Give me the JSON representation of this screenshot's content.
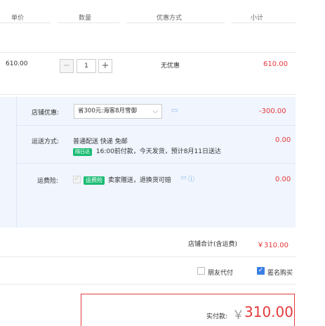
{
  "header": {
    "col_price": "单价",
    "col_qty": "数量",
    "col_discount": "优惠方式",
    "col_subtotal": "小计"
  },
  "item": {
    "unit_price": "610.00",
    "quantity": "1",
    "minus": "−",
    "plus": "+",
    "discount": "无优惠",
    "subtotal": "610.00"
  },
  "shop_discount": {
    "label": "店铺优惠:",
    "selected": "省300元:海客8月雪御",
    "amount": "-300.00"
  },
  "shipping": {
    "label": "运送方式:",
    "method": "普通配送 快递 免邮",
    "badge": "隔日达",
    "detail": "16:00前付款，今天发货，预计8月11日送达",
    "amount": "0.00"
  },
  "insurance": {
    "label": "运费险:",
    "badge": "运费险",
    "text": "卖家赠送，退换货可赔",
    "amount": "0.00"
  },
  "shop_total": {
    "label": "店铺合计(含运费)",
    "value": "￥310.00"
  },
  "options": {
    "friend_pay": "朋友代付",
    "anonymous": "匿名购买"
  },
  "payment": {
    "label": "实付款:",
    "currency": "￥",
    "value": "310.00"
  },
  "colors": {
    "accent_red": "#e4393c",
    "panel_bg": "#f0f5fe",
    "badge_green": "#1bbc74",
    "checkbox_blue": "#3a7fe6"
  }
}
